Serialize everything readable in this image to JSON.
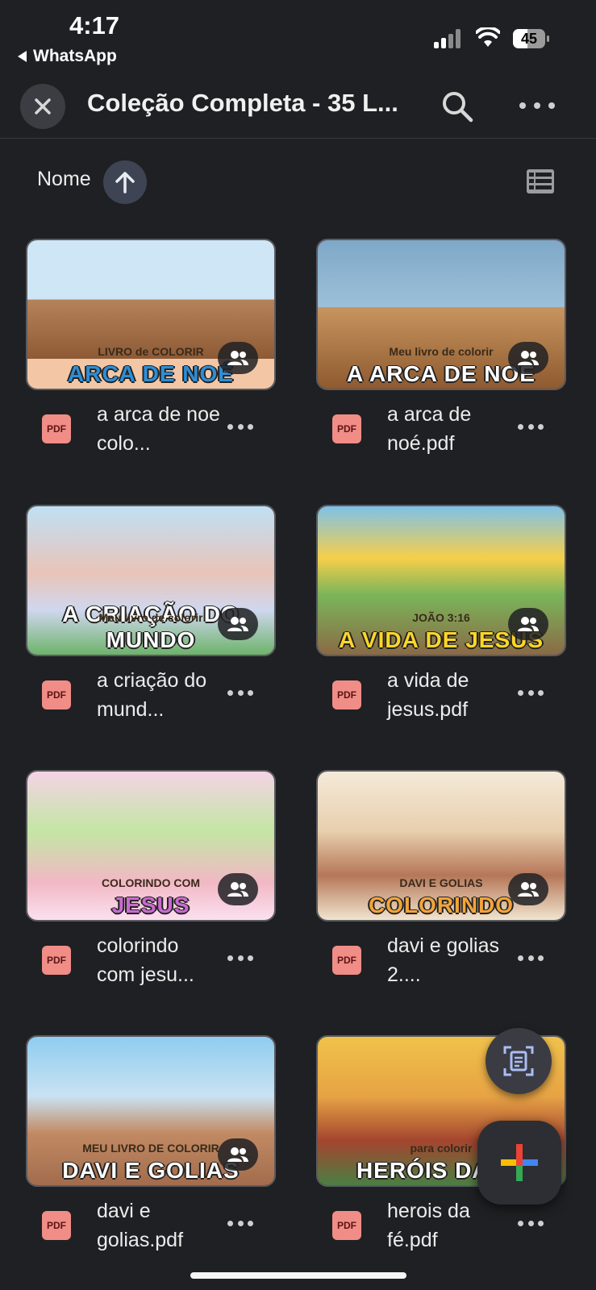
{
  "status_bar": {
    "time": "4:17",
    "back_app": "WhatsApp",
    "battery": "45",
    "battery_level": 0.45
  },
  "toolbar": {
    "title": "Coleção Completa - 35 L..."
  },
  "sort": {
    "label": "Nome"
  },
  "files": [
    {
      "name": "a arca de noe colo...",
      "thumb_text": "ARCA DE NOÉ",
      "thumb_subtext": "LIVRO de COLORIR",
      "type": "PDF"
    },
    {
      "name": "a arca de noé.pdf",
      "thumb_text": "A ARCA DE NOÉ",
      "thumb_subtext": "Meu livro de colorir",
      "type": "PDF"
    },
    {
      "name": "a criação do mund...",
      "thumb_text": "A CRIAÇÃO DO MUNDO",
      "thumb_subtext": "Meu livro de colorir",
      "type": "PDF"
    },
    {
      "name": "a vida de jesus.pdf",
      "thumb_text": "A VIDA DE JESUS",
      "thumb_subtext": "JOÃO 3:16",
      "type": "PDF"
    },
    {
      "name": "colorindo com jesu...",
      "thumb_text": "JESUS",
      "thumb_subtext": "COLORINDO COM",
      "type": "PDF"
    },
    {
      "name": "davi e golias 2....",
      "thumb_text": "COLORINDO",
      "thumb_subtext": "DAVI E GOLIAS",
      "type": "PDF"
    },
    {
      "name": "davi e golias.pdf",
      "thumb_text": "DAVI E GOLIAS",
      "thumb_subtext": "MEU LIVRO DE COLORIR",
      "type": "PDF"
    },
    {
      "name": "herois da fé.pdf",
      "thumb_text": "HERÓIS DA FÉ",
      "thumb_subtext": "para colorir",
      "type": "PDF"
    }
  ],
  "colors": {
    "background": "#1f2023",
    "pdf_badge": "#f08d86",
    "sort_button": "#3e4453"
  }
}
